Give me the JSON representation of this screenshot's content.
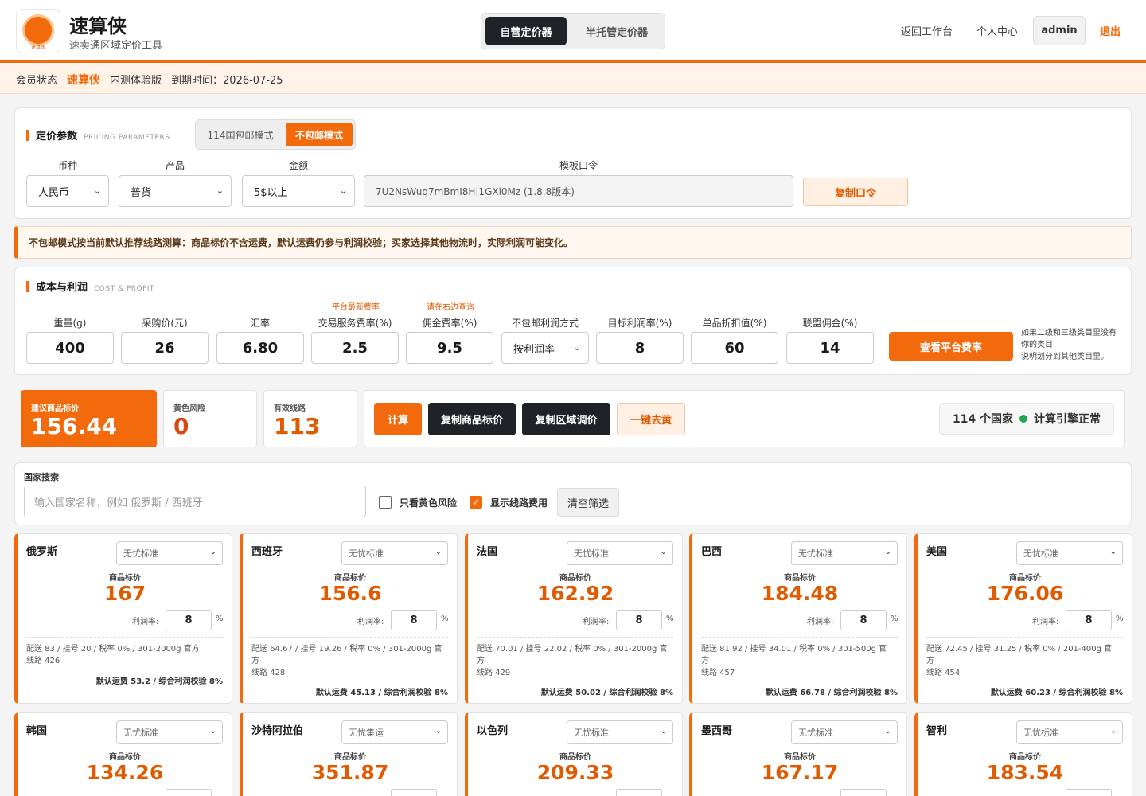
{
  "app": {
    "logo_text": "速算侠",
    "title": "速算侠",
    "subtitle": "速卖通区域定价工具",
    "mode_tabs": [
      "自营定价器",
      "半托管定价器"
    ],
    "nav": [
      "返回工作台",
      "个人中心",
      "admin",
      "退出"
    ]
  },
  "member": {
    "label": "会员状态",
    "name": "速算侠",
    "edition": "内测体验版",
    "expiry": "到期时间：2026-07-25"
  },
  "pricing": {
    "title": "定价参数",
    "title_en": "PRICING PARAMETERS",
    "shipping_modes": [
      "114国包邮模式",
      "不包邮模式"
    ],
    "labels": {
      "currency": "币种",
      "product": "产品",
      "amount": "金额",
      "template": "模板口令"
    },
    "currency": "人民币",
    "product": "普货",
    "amount": "5$以上",
    "template_token": "7U2NsWuq7mBmI8H|1GXi0Mz (1.8.8版本)",
    "copy_btn": "复制口令"
  },
  "notice": "不包邮模式按当前默认推荐线路测算：商品标价不含运费，默认运费仍参与利润校验；买家选择其他物流时，实际利润可能变化。",
  "cost": {
    "title": "成本与利润",
    "title_en": "COST & PROFIT",
    "hint_fee": "平台最新费率",
    "hint_commission": "请在右边查询",
    "fields": [
      {
        "label": "重量(g)",
        "value": "400"
      },
      {
        "label": "采购价(元)",
        "value": "26"
      },
      {
        "label": "汇率",
        "value": "6.80"
      },
      {
        "label": "交易服务费率(%)",
        "value": "2.5"
      },
      {
        "label": "佣金费率(%)",
        "value": "9.5"
      },
      {
        "label": "不包邮利润方式",
        "value": "按利润率"
      },
      {
        "label": "目标利润率(%)",
        "value": "8"
      },
      {
        "label": "单品折扣值(%)",
        "value": "60"
      },
      {
        "label": "联盟佣金(%)",
        "value": "14"
      }
    ],
    "rate_btn": "查看平台费率",
    "side_note": [
      "如果二级和三级类目里没有",
      "你的类目,",
      "说明划分到其他类目里。"
    ]
  },
  "summary": {
    "suggested_label": "建议商品标价",
    "suggested_value": "156.44",
    "risk_label": "黄色风险",
    "risk_value": "0",
    "routes_label": "有效线路",
    "routes_value": "113",
    "buttons": [
      "计算",
      "复制商品标价",
      "复制区域调价",
      "一键去黄"
    ],
    "engine_count": "114 个国家",
    "engine_status": "计算引擎正常",
    "engine_status_color": "#1fa84f"
  },
  "filter": {
    "label": "国家搜索",
    "placeholder": "输入国家名称，例如 俄罗斯 / 西班牙",
    "only_yellow": "只看黄色风险",
    "show_fees": "显示线路费用",
    "show_fees_checked": true,
    "clear_btn": "清空筛选"
  },
  "card_labels": {
    "price": "商品标价",
    "profit": "利润率:",
    "pct": "%"
  },
  "countries": [
    {
      "name": "俄罗斯",
      "service": "无忧标准",
      "price": "167",
      "profit": "8",
      "fees": "配送 83 / 挂号 20 / 税率 0% / 301-2000g 官方",
      "route": "线路 426",
      "summary": "默认运费 53.2 / 综合利润校验 8%"
    },
    {
      "name": "西班牙",
      "service": "无忧标准",
      "price": "156.6",
      "profit": "8",
      "fees": "配送 64.67 / 挂号 19.26 / 税率 0% / 301-2000g 官方",
      "route": "线路 428",
      "summary": "默认运费 45.13 / 综合利润校验 8%"
    },
    {
      "name": "法国",
      "service": "无忧标准",
      "price": "162.92",
      "profit": "8",
      "fees": "配送 70.01 / 挂号 22.02 / 税率 0% / 301-2000g 官方",
      "route": "线路 429",
      "summary": "默认运费 50.02 / 综合利润校验 8%"
    },
    {
      "name": "巴西",
      "service": "无忧标准",
      "price": "184.48",
      "profit": "8",
      "fees": "配送 81.92 / 挂号 34.01 / 税率 0% / 301-500g 官方",
      "route": "线路 457",
      "summary": "默认运费 66.78 / 综合利润校验 8%"
    },
    {
      "name": "美国",
      "service": "无忧标准",
      "price": "176.06",
      "profit": "8",
      "fees": "配送 72.45 / 挂号 31.25 / 税率 0% / 201-400g 官方",
      "route": "线路 454",
      "summary": "默认运费 60.23 / 综合利润校验 8%"
    },
    {
      "name": "韩国",
      "service": "无忧标准",
      "price": "134.26",
      "profit": "",
      "fees": "",
      "route": "",
      "summary": ""
    },
    {
      "name": "沙特阿拉伯",
      "service": "无忧集运",
      "price": "351.87",
      "profit": "",
      "fees": "",
      "route": "",
      "summary": ""
    },
    {
      "name": "以色列",
      "service": "无忧标准",
      "price": "209.33",
      "profit": "",
      "fees": "",
      "route": "",
      "summary": ""
    },
    {
      "name": "墨西哥",
      "service": "无忧标准",
      "price": "167.17",
      "profit": "",
      "fees": "",
      "route": "",
      "summary": ""
    },
    {
      "name": "智利",
      "service": "无忧标准",
      "price": "183.54",
      "profit": "",
      "fees": "",
      "route": "",
      "summary": ""
    }
  ],
  "colors": {
    "accent": "#f26a0c",
    "dark": "#1f2327"
  }
}
